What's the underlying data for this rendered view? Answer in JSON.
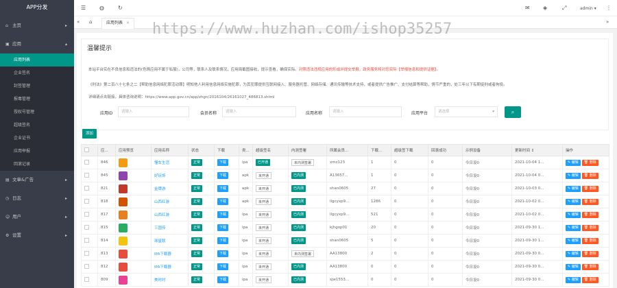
{
  "sidebar": {
    "brand": "APP分发",
    "items": [
      {
        "label": "主页",
        "icon": "home-icon",
        "arrow": "▸"
      },
      {
        "label": "应用",
        "icon": "app-icon",
        "arrow": "▴"
      },
      {
        "label": "文章&广告",
        "icon": "article-icon",
        "arrow": "▸"
      },
      {
        "label": "日志",
        "icon": "log-icon",
        "arrow": "▸"
      },
      {
        "label": "用户",
        "icon": "user-icon",
        "arrow": "▸"
      },
      {
        "label": "设置",
        "icon": "settings-icon",
        "arrow": "▸"
      }
    ],
    "sub_items": [
      "应用列表",
      "企业签名",
      "封签管理",
      "报毒管理",
      "授权号管理",
      "超级签名",
      "企业证书",
      "应用举报",
      "回滚记录"
    ]
  },
  "topbar": {
    "user": "admin ▾"
  },
  "tab": {
    "label": "应用列表"
  },
  "watermark": "https://www.huzhan.com/ishop35257",
  "notice": {
    "title": "温馨提示",
    "lines": [
      {
        "text": "本站平台实在不良信息和违法的(色情应用不属于私服)，公司等，联系人及联系情况，应用简截图接收，提示查看，确保实际。",
        "red": "对照违法违规应用的形成并提交举报，政务服务将对您实际【举报信息和提供证据】。"
      },
      {
        "text": "《刑法》第二百八十七条之二【帮助信息网络犯罪活动罪】明知他人利用信息网络实施犯罪，为其犯罪提供互联网接入、服务器托管、网络存储、通讯传输等技术支持，或者提供广告推广、支付结算等帮助，情节严重的，处三年以下有期徒刑或者拘役。",
        "red": ""
      },
      {
        "text": "详细请点击链接，具体咨询说明：https://www.app.gov.cn/app/zhgn/2016104/26161027_486813.shtml",
        "red": ""
      }
    ]
  },
  "filters": [
    {
      "label": "应用ID",
      "placeholder": "请输入"
    },
    {
      "label": "会员名称",
      "placeholder": "请输入"
    },
    {
      "label": "应用名称",
      "placeholder": "请输入"
    },
    {
      "label": "应用平台",
      "placeholder": "请选择"
    }
  ],
  "add_button": "添加",
  "table": {
    "headers": [
      "",
      "应...",
      "应用预览",
      "应用名称",
      "状态",
      "下载",
      "类...",
      "超级签名",
      "内测签署",
      "所属会员...",
      "下载...",
      "超级签下载",
      "回滚成功",
      "示例设备",
      "更新时间 ↕",
      "操作"
    ],
    "rows": [
      {
        "id": "846",
        "name": "懂车生活",
        "status": "正常",
        "dl": "下载",
        "type": "ipa",
        "sig": "已开通",
        "sign2": "未内测签署",
        "member": "xmz123",
        "c1": "1",
        "c2": "0",
        "c3": "0",
        "dev": "今日设0",
        "time": "2021-10-04 1...",
        "color": "#f39c12"
      },
      {
        "id": "845",
        "name": "好玩饰",
        "status": "正常",
        "dl": "下载",
        "type": "apk",
        "sig": "未开通",
        "sign2": "已内测",
        "member": "A13657...",
        "c1": "1",
        "c2": "0",
        "c3": "0",
        "dev": "今日设0",
        "time": "2021-10-04 0...",
        "color": "#8e44ad"
      },
      {
        "id": "821",
        "name": "金牌游",
        "status": "正常",
        "dl": "下载",
        "type": "apk",
        "sig": "未开通",
        "sign2": "已内测",
        "member": "shan0605",
        "c1": "27",
        "c2": "0",
        "c3": "0",
        "dev": "今日设0",
        "time": "2021-10-03 0...",
        "color": "#c0392b"
      },
      {
        "id": "818",
        "name": "山西红游",
        "status": "正常",
        "dl": "下载",
        "type": "apk",
        "sig": "未开通",
        "sign2": "已内测",
        "member": "llgcyxp9...",
        "c1": "1286",
        "c2": "0",
        "c3": "0",
        "dev": "今日设0",
        "time": "2021-10-02 0...",
        "color": "#d35400"
      },
      {
        "id": "817",
        "name": "山西红游",
        "status": "正常",
        "dl": "下载",
        "type": "ipa",
        "sig": "未开通",
        "sign2": "已内测",
        "member": "llgcyxp9...",
        "c1": "521",
        "c2": "0",
        "c3": "0",
        "dev": "今日设0",
        "time": "2021-10-02 0...",
        "color": "#e67e22"
      },
      {
        "id": "815",
        "name": "三国传",
        "status": "正常",
        "dl": "下载",
        "type": "ipa",
        "sig": "未开通",
        "sign2": "已内测",
        "member": "kjhgop01",
        "c1": "20",
        "c2": "0",
        "c3": "0",
        "dev": "今日设0",
        "time": "2021-09-30 1...",
        "color": "#27ae60"
      },
      {
        "id": "814",
        "name": "球星联",
        "status": "正常",
        "dl": "下载",
        "type": "ipa",
        "sig": "未开通",
        "sign2": "已内测",
        "member": "shan0605",
        "c1": "5",
        "c2": "0",
        "c3": "0",
        "dev": "今日设0",
        "time": "2021-09-30 1...",
        "color": "#f1c40f"
      },
      {
        "id": "813",
        "name": "IPA下载器",
        "status": "正常",
        "dl": "下载",
        "type": "ipa",
        "sig": "未开通",
        "sign2": "未内测签署",
        "member": "AA13800",
        "c1": "2",
        "c2": "0",
        "c3": "0",
        "dev": "今日设0",
        "time": "2021-09-30 0...",
        "color": "#e74c3c"
      },
      {
        "id": "812",
        "name": "IPA下载器",
        "status": "正常",
        "dl": "下载",
        "type": "ipa",
        "sig": "未开通",
        "sign2": "已内测",
        "member": "AA13800",
        "c1": "0",
        "c2": "0",
        "c3": "0",
        "dev": "今日设0",
        "time": "2021-09-30 0...",
        "color": "#e74c3c"
      },
      {
        "id": "809",
        "name": "美时时",
        "status": "正常",
        "dl": "下载",
        "type": "ipa",
        "sig": "未开通",
        "sign2": "已内测",
        "member": "sjw1553...",
        "c1": "0",
        "c2": "0",
        "c3": "0",
        "dev": "今日设0",
        "time": "2021-09-30 0...",
        "color": "#e84393"
      }
    ],
    "edit_label": "✎ 编辑",
    "delete_label": "🗑 删除"
  }
}
